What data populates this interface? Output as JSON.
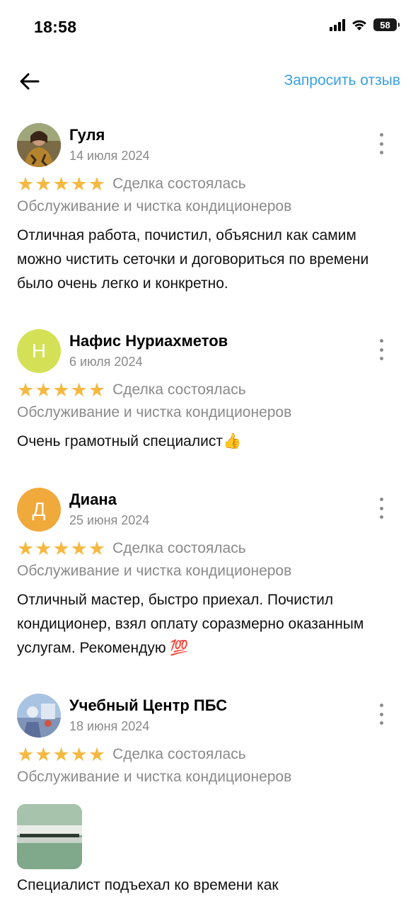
{
  "status_bar": {
    "time": "18:58",
    "battery": "58"
  },
  "nav": {
    "back_icon": "arrow-left-icon",
    "request_review": "Запросить отзыв"
  },
  "colors": {
    "accent": "#3aa0e4",
    "star": "#f5b942",
    "secondary_text": "#8a8a8a"
  },
  "reviews": [
    {
      "name": "Гуля",
      "date": "14 июля 2024",
      "avatar": "photo",
      "rating": 5,
      "status": "Сделка состоялась",
      "service": "Обслуживание и чистка кондиционеров",
      "text": "Отличная работа, почистил, объяснил как самим можно чистить сеточки и договориться по времени было очень легко и конкретно."
    },
    {
      "name": "Нафис Нуриахметов",
      "date": "6 июля 2024",
      "avatar_letter": "Н",
      "avatar_color": "#d4e157",
      "rating": 5,
      "status": "Сделка состоялась",
      "service": "Обслуживание и чистка кондиционеров",
      "text": "Очень грамотный специалист👍"
    },
    {
      "name": "Диана",
      "date": "25 июня 2024",
      "avatar_letter": "Д",
      "avatar_color": "#f0a93b",
      "rating": 5,
      "status": "Сделка состоялась",
      "service": "Обслуживание и чистка кондиционеров",
      "text": "Отличный мастер, быстро приехал. Почистил кондиционер, взял оплату соразмерно оказанным услугам. Рекомендую 💯"
    },
    {
      "name": "Учебный Центр ПБС",
      "date": "18 июня 2024",
      "avatar": "photo",
      "rating": 5,
      "status": "Сделка состоялась",
      "service": "Обслуживание и чистка кондиционеров",
      "photo": "air-conditioner-photo",
      "text": "Специалист подъехал ко времени как"
    }
  ]
}
